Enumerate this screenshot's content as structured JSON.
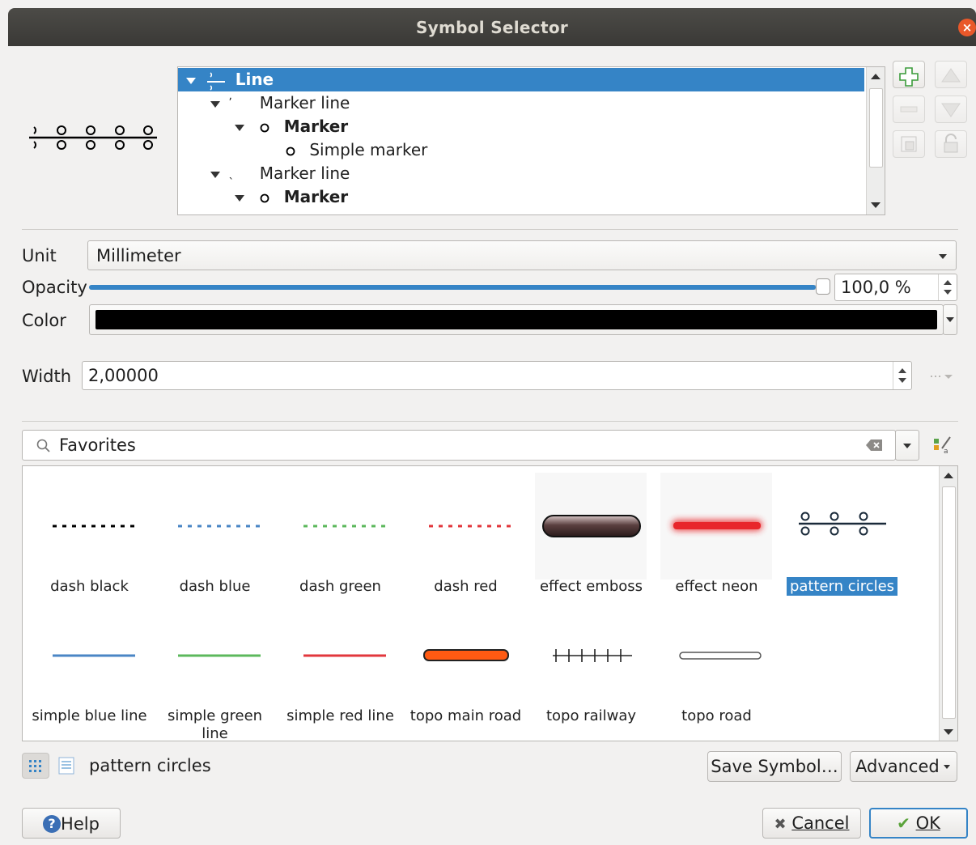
{
  "window": {
    "title": "Symbol Selector"
  },
  "tree": {
    "rows": [
      {
        "label": "Line",
        "bold": true
      },
      {
        "label": "Marker line",
        "bold": false
      },
      {
        "label": "Marker",
        "bold": true
      },
      {
        "label": "Simple marker",
        "bold": false
      },
      {
        "label": "Marker line",
        "bold": false
      },
      {
        "label": "Marker",
        "bold": true
      }
    ]
  },
  "properties": {
    "unit_label": "Unit",
    "unit_value": "Millimeter",
    "opacity_label": "Opacity",
    "opacity_value": "100,0 %",
    "opacity_fraction": 1.0,
    "color_label": "Color",
    "color_value": "#000000",
    "width_label": "Width",
    "width_value": "2,00000"
  },
  "library": {
    "search_value": "Favorites",
    "symbols": [
      {
        "name": "dash  black"
      },
      {
        "name": "dash blue"
      },
      {
        "name": "dash green"
      },
      {
        "name": "dash red"
      },
      {
        "name": "effect emboss"
      },
      {
        "name": "effect neon"
      },
      {
        "name": "pattern circles",
        "selected": true
      },
      {
        "name": "simple blue line"
      },
      {
        "name": "simple green line"
      },
      {
        "name": "simple red line"
      },
      {
        "name": "topo main road"
      },
      {
        "name": "topo railway"
      },
      {
        "name": "topo road"
      }
    ],
    "selected_name": "pattern circles"
  },
  "buttons": {
    "save_symbol": "Save Symbol…",
    "advanced": "Advanced",
    "help": "Help",
    "cancel": "Cancel",
    "ok": "OK"
  },
  "colors": {
    "selection": "#3584c6",
    "dash_black": "#000000",
    "dash_blue": "#4a86c5",
    "dash_green": "#5cb85c",
    "dash_red": "#e2373c",
    "neon": "#e8252b",
    "main_road": "#ff5a12"
  }
}
